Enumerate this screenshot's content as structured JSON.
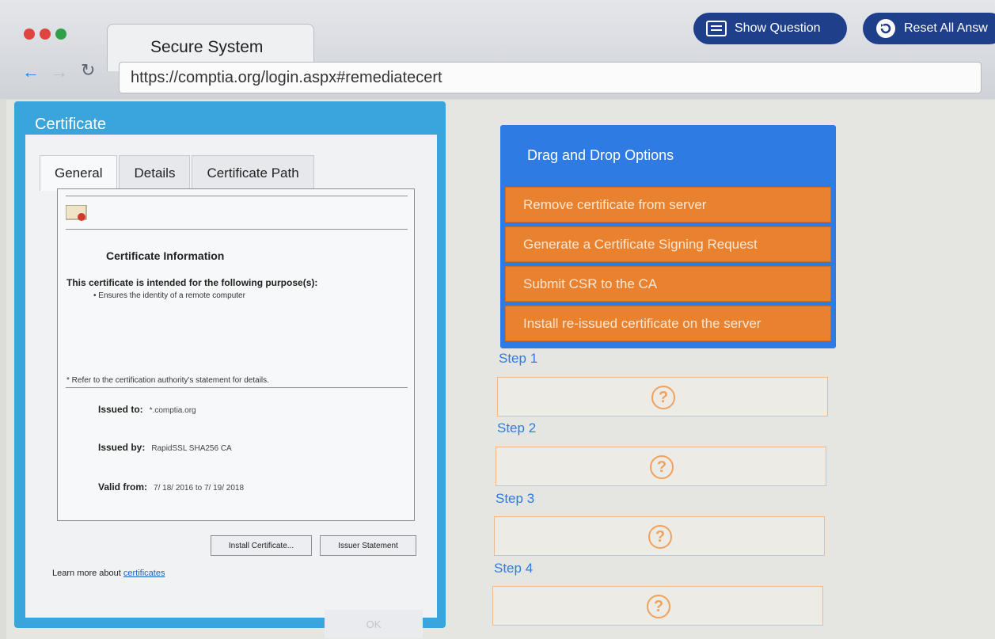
{
  "browser": {
    "tab_title": "Secure System",
    "url": "https://comptia.org/login.aspx#remediatecert",
    "show_question_label": "Show Question",
    "reset_label": "Reset All Answ"
  },
  "certificate": {
    "window_title": "Certificate",
    "tabs": [
      "General",
      "Details",
      "Certificate Path"
    ],
    "info_title": "Certificate Information",
    "purpose_heading": "This certificate is intended for the following purpose(s):",
    "purpose_item": "• Ensures the identity of a remote computer",
    "refer_note": "* Refer to the certification authority's statement for details.",
    "issued_to_label": "Issued to:",
    "issued_to_value": "*.comptia.org",
    "issued_by_label": "Issued by:",
    "issued_by_value": "RapidSSL SHA256 CA",
    "valid_from_label": "Valid from:",
    "valid_from_value": "7/ 18/ 2016  to  7/ 19/ 2018",
    "install_button": "Install Certificate...",
    "issuer_button": "Issuer Statement",
    "learn_more_text": "Learn more about",
    "learn_more_link": "certificates",
    "ok_button": "OK"
  },
  "drag_drop": {
    "header": "Drag and Drop Options",
    "options": [
      "Remove certificate from server",
      "Generate a Certificate Signing Request",
      "Submit CSR to the CA",
      "Install re-issued certificate on the server"
    ]
  },
  "steps": [
    {
      "label": "Step 1",
      "placeholder": "?"
    },
    {
      "label": "Step 2",
      "placeholder": "?"
    },
    {
      "label": "Step 3",
      "placeholder": "?"
    },
    {
      "label": "Step 4",
      "placeholder": "?"
    }
  ],
  "colors": {
    "accent_blue": "#2d7be3",
    "option_orange": "#e9822f",
    "window_blue": "#3aa4dc"
  }
}
